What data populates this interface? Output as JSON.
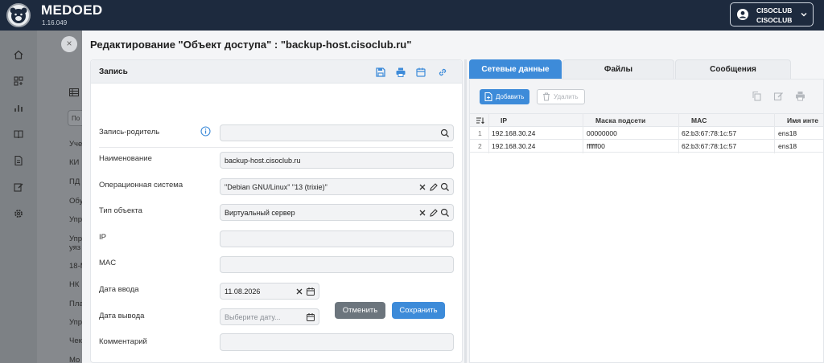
{
  "app": {
    "brand": "MEDOED",
    "version": "1.16.049"
  },
  "user": {
    "line1": "CISOCLUB",
    "line2": "CISOCLUB"
  },
  "background_list": {
    "filter_placeholder": "По",
    "items": [
      "Уче",
      "КИ",
      "ПД",
      "Обу",
      "Упр",
      "Упр",
      "уяз",
      "18-М",
      "НК",
      "Пла",
      "Упр",
      "Чек",
      "Мо"
    ]
  },
  "modal": {
    "title": "Редактирование \"Объект доступа\" : \"backup-host.cisoclub.ru\"",
    "close_label": "×"
  },
  "record": {
    "header": "Запись",
    "fields": {
      "parent": {
        "label": "Запись-родитель",
        "value": ""
      },
      "name": {
        "label": "Наименование",
        "value": "backup-host.cisoclub.ru"
      },
      "os": {
        "label": "Операционная система",
        "value": "\"Debian GNU/Linux\" \"13 (trixie)\""
      },
      "type": {
        "label": "Тип объекта",
        "value": "Виртуальный сервер"
      },
      "ip": {
        "label": "IP",
        "value": ""
      },
      "mac": {
        "label": "MAC",
        "value": ""
      },
      "date_in": {
        "label": "Дата ввода",
        "value": "11.08.2026"
      },
      "date_out": {
        "label": "Дата вывода",
        "placeholder": "Выберите дату..."
      },
      "comment": {
        "label": "Комментарий",
        "value": ""
      }
    },
    "cancel_label": "Отменить",
    "save_label": "Сохранить"
  },
  "tabs": [
    {
      "label": "Сетевые данные",
      "active": true
    },
    {
      "label": "Файлы",
      "active": false
    },
    {
      "label": "Сообщения",
      "active": false
    }
  ],
  "network": {
    "add_label": "Добавить",
    "delete_label": "Удалить",
    "columns": [
      "IP",
      "Маска подсети",
      "MAC",
      "Имя инте"
    ],
    "rows": [
      {
        "n": "1",
        "ip": "192.168.30.24",
        "mask": "00000000",
        "mac": "62:b3:67:78:1c:57",
        "iface": "ens18"
      },
      {
        "n": "2",
        "ip": "192.168.30.24",
        "mask": "ffffff00",
        "mac": "62:b3:67:78:1c:57",
        "iface": "ens18"
      }
    ]
  },
  "colors": {
    "topbar": "#1d2a3e",
    "accent": "#3d8bd9",
    "cancel": "#6c757d"
  }
}
